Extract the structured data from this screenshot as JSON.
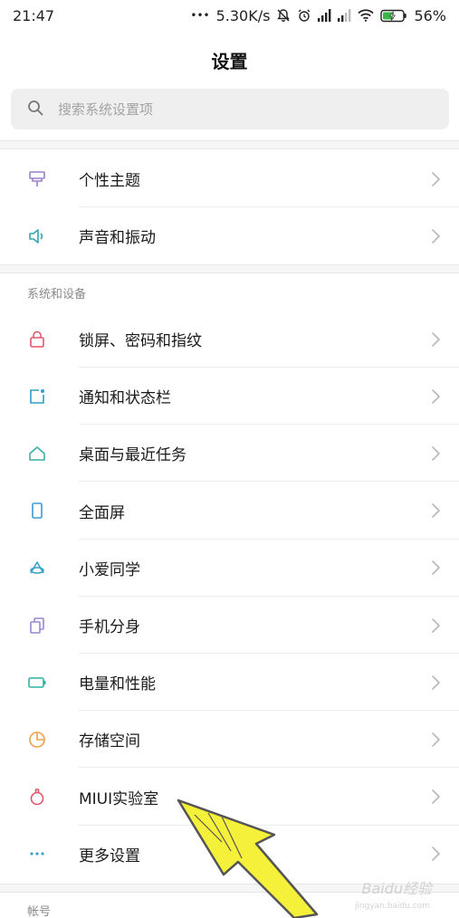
{
  "status_bar": {
    "time": "21:47",
    "dots": "•••",
    "speed": "5.30K/s",
    "battery": "56%",
    "battery_level": 0.56
  },
  "title": "设置",
  "search": {
    "placeholder": "搜索系统设置项"
  },
  "group1": [
    {
      "label": "个性主题",
      "icon": "theme-icon",
      "color": "#9b7fd1"
    },
    {
      "label": "声音和振动",
      "icon": "speaker-icon",
      "color": "#2fa7b0"
    }
  ],
  "section_label": "系统和设备",
  "group2": [
    {
      "label": "锁屏、密码和指纹",
      "icon": "lock-icon",
      "color": "#e3556c"
    },
    {
      "label": "通知和状态栏",
      "icon": "notification-icon",
      "color": "#2e9fc4"
    },
    {
      "label": "桌面与最近任务",
      "icon": "home-icon",
      "color": "#3ab0a6"
    },
    {
      "label": "全面屏",
      "icon": "phone-icon",
      "color": "#3a9bd6"
    },
    {
      "label": "小爱同学",
      "icon": "xiaoai-icon",
      "color": "#3aa3c9"
    },
    {
      "label": "手机分身",
      "icon": "dual-phone-icon",
      "color": "#9b86d3"
    },
    {
      "label": "电量和性能",
      "icon": "battery-icon",
      "color": "#2fb2a5"
    },
    {
      "label": "存储空间",
      "icon": "storage-icon",
      "color": "#f0a04a"
    },
    {
      "label": "MIUI实验室",
      "icon": "flask-icon",
      "color": "#e3556c"
    },
    {
      "label": "更多设置",
      "icon": "more-icon",
      "color": "#3aa6c4"
    }
  ],
  "section_label_2": "帐号",
  "watermark": "Baidu经验",
  "watermark_sub": "jingyan.baidu.com",
  "colors": {
    "arrow_fill": "#f5f03a",
    "arrow_stroke": "#555555"
  }
}
